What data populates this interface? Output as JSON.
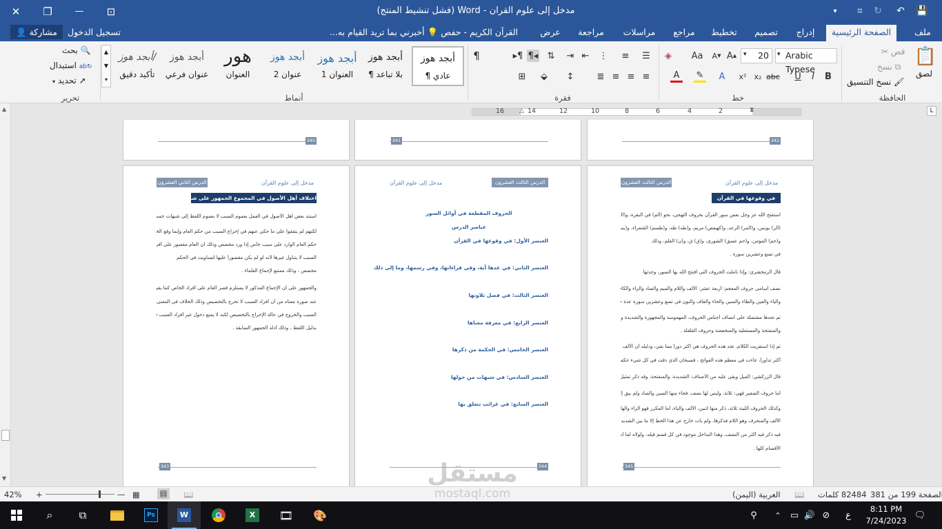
{
  "window": {
    "title": "مدخل إلى علوم القران - Word (فشل تنشيط المنتج)"
  },
  "tabs": [
    {
      "label": "ملف"
    },
    {
      "label": "الصفحة الرئيسية"
    },
    {
      "label": "إدراج"
    },
    {
      "label": "تصميم"
    },
    {
      "label": "تخطيط"
    },
    {
      "label": "مراجع"
    },
    {
      "label": "مراسلات"
    },
    {
      "label": "مراجعة"
    },
    {
      "label": "عرض"
    },
    {
      "label": "القرآن الكريم - حفص"
    }
  ],
  "tell_me": "أخبرني بما تريد القيام به...",
  "sign_in": "تسجيل الدخول",
  "share": "مشاركة",
  "ribbon": {
    "clipboard": {
      "label": "الحافظة",
      "paste": "لصق",
      "cut": "قص",
      "copy": "نسخ",
      "format_painter": "نسخ التنسيق"
    },
    "font": {
      "label": "خط",
      "name": "Arabic Typese",
      "size": "20"
    },
    "paragraph": {
      "label": "فقرة"
    },
    "styles": {
      "label": "أنماط",
      "items": [
        {
          "preview": "أبجد هوز",
          "name": "¶ عادي"
        },
        {
          "preview": "أبجد هوز",
          "name": "¶ بلا تباعد"
        },
        {
          "preview": "أبجد هوز",
          "name": "العنوان 1"
        },
        {
          "preview": "أبجد هوز",
          "name": "عنوان 2"
        },
        {
          "preview": "هور",
          "name": "العنوان"
        },
        {
          "preview": "أبجد هوز",
          "name": "عنوان فرعي"
        },
        {
          "preview": "أبجد هوز/",
          "name": "تأكيد دقيق"
        }
      ]
    },
    "editing": {
      "label": "تحرير",
      "find": "بحث",
      "replace": "استبدال",
      "select": "تحديد"
    }
  },
  "ruler": {
    "numbers": [
      "2",
      "4",
      "6",
      "8",
      "10",
      "12",
      "14",
      "16"
    ]
  },
  "pages_top": [
    {
      "number": "340"
    },
    {
      "number": "341"
    },
    {
      "number": "342"
    }
  ],
  "pages": {
    "left": {
      "number": "343",
      "header_title": "مدخل إلى علوم القرآن",
      "lesson": "الدرس الثاني العشرون",
      "section": "اختلاف أهل الأصول في المجموع الجمهور على شبهات خمس",
      "lines": [
        "استند بعض أهل الأصول في العمل بعموم السبب لا بعموم اللفظ إلى شبهات خمس",
        "لكنهم لم يتفقوا على ما حكي عنهم في إخراج السبب من حكم العام وإنما وقع الخلاف في ذلك",
        "حكم العام الوارد على سبب خاص إذا ورد مخصص وذلك أن العام مقصور على أفراد",
        "السبب لا يتناول غيرها لأنه لو لم يكن مقصوراً عليها لتساويت في الحكم",
        "مخصص ، وذلك ممتنع لإجماع العلماء .",
        "والجمهور على أن الإجماع المذكور لا يستلزم قصر العام على أفراد الخاص كما يقولون",
        "عند صورة معناه من أن أفراد السبب لا تخرج بالتخصيص وذلك الخلاف في المعنى بين أفراد",
        "السبب والخروج في حالة الإخراج بالتخصيص لكنه لا يمنع دخول غير أفراد السبب في حكم العام",
        "بدليل اللفظ ، وذلك أدلة الجمهور السابقة ."
      ]
    },
    "middle": {
      "number": "344",
      "header_title": "مدخل إلى علوم القرآن",
      "lesson": "الدرس الثالث العشرون",
      "heading": "الحروف المقطعة في أوائل السور",
      "subheading": "عناصر الدرس",
      "items": [
        "العنصر الأول: في وقوعها في القرآن",
        "العنصر الثاني: في عدها آية، وفي قراءاتها، وفي رسمها، وما إلى ذلك",
        "العنصر الثالث: في فضل تلاوتها",
        "العنصر الرابع: في معرفة معناها",
        "العنصر الخامس: في الحكمة من ذكرها",
        "العنصر السادس: في شبهات من حولها",
        "العنصر السابع: في غرائب تتعلق بها"
      ]
    },
    "right": {
      "number": "345",
      "header_title": "مدخل إلى علوم القرآن",
      "lesson": "الدرس الثالث العشرون",
      "section": "في وقوعها في القرآن",
      "lines": [
        "استفتح الله عز وجل بعض سور القرآن بحروف التهجي، نحو (الم) في البقرة، و(المص) الأعراف",
        "(الر) يونس، و(المر) الرعد، و(كهيعص) مريم، و(طه) طه، و(طسم) الشعراء، و(يس) يس",
        "و(حم) المؤمن، و(حم عسق) الشورى، و(ق) ق، و(ن) القلم، وذلك",
        "في تسع وعشرين سورة .",
        "قال الزمخشري: وإذا تأملت الحروف التي افتتح الله بها السور، وجدتها",
        "نصف أسامي حروف المعجم: أربعة عشر: الألف واللام والميم والصاد والراء والكاف والهاء",
        "والياء والعين والطاء والسين والحاء والقاف والنون في تسع وعشرين سورة عدة حروف المعجم .",
        "ثم تجدها مشتملة على أنصاف أجناس الحروف، المهموسة والمجهورة والشديدة والمطبقة",
        "والمنفتحة والمستعلية والمنخفضة وحروف القلقلة .",
        "ثم إذا استقريت الكلام، تجد هذه الحروف هي أكثر دوراً مما بقي، ودليله أن الألف واللام لما كانت",
        "أكثر تداوراً، جاءت في معظم هذه الفواتح ، فسبحان الذي دقت في كل شيء حكمته لا انتهى .",
        "قال الزركشي: الميل وبقي عليه من الأصناف: الشديدة، والمنفتحة، وقد ذكر تمثيل نصفها .",
        "أما حروف الصفير فهي: ثلاثة، وليس لها نصف، فجاء منها السين والصاد ولم يبق إلا الزاي .",
        "وكذلك الحروف اللينة ثلاثة، ذكر منها اثنين، الألف والياء، أما المكرر فهو الراء والهاوي وهو",
        "الألف والمنحرف وهو اللام فذكرها، ولم يأت خارج عن هذا الخط إلا ما بين الشديدة والرخوة",
        "فيه ذكر فيه أكثر من النصف، وهذا التداخل موجود في كل قسم قبله، ولولاه لما انقسمت هذه",
        "الأقسام كلها ."
      ]
    }
  },
  "status": {
    "page": "الصفحة 199 من 381",
    "words": "82484 كلمات",
    "language": "العربية (اليمن)",
    "zoom": "42%"
  },
  "clock": {
    "time": "8:11 PM",
    "date": "7/24/2023"
  },
  "tray": {
    "lang": "ع"
  },
  "watermark": {
    "brand": "مستقل",
    "url": "mostaql.com"
  }
}
